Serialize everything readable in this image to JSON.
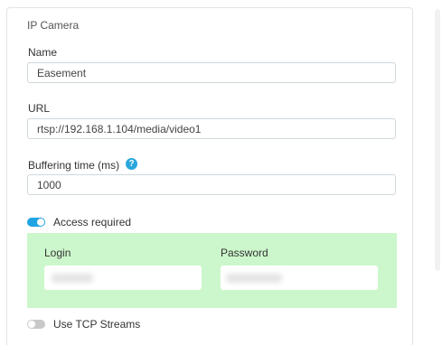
{
  "panel": {
    "section_title": "IP Camera"
  },
  "name_field": {
    "label": "Name",
    "value": "Easement"
  },
  "url_field": {
    "label": "URL",
    "value": "rtsp://192.168.1.104/media/video1"
  },
  "buffering_field": {
    "label": "Buffering time (ms)",
    "help_glyph": "?",
    "value": "1000"
  },
  "access_toggle": {
    "label": "Access required",
    "state": "on",
    "color": "#1fa3e3"
  },
  "credentials": {
    "background": "#ccf7cc",
    "login_label": "Login",
    "password_label": "Password"
  },
  "tcp_toggle": {
    "label": "Use TCP Streams",
    "state": "off"
  }
}
